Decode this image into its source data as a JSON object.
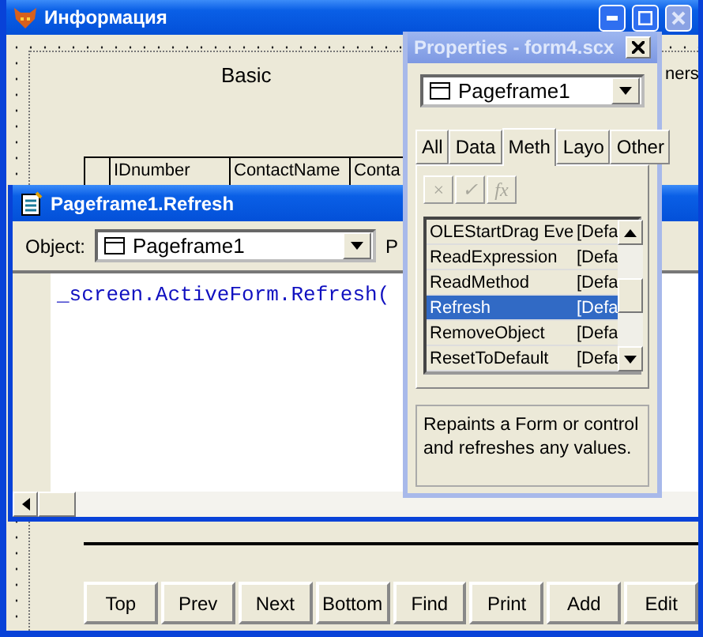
{
  "main_window": {
    "title": "Информация",
    "active": true,
    "page_tabs": [
      "Basic",
      "ners"
    ],
    "grid_columns": [
      "IDnumber",
      "ContactName",
      "Conta"
    ],
    "buttons": [
      "Top",
      "Prev",
      "Next",
      "Bottom",
      "Find",
      "Print",
      "Add",
      "Edit"
    ]
  },
  "code_window": {
    "title": "Pageframe1.Refresh",
    "active": true,
    "object_label": "Object:",
    "object_value": "Pageframe1",
    "procedure_label": "P",
    "code": "_screen.ActiveForm.Refresh("
  },
  "properties": {
    "title": "Properties - form4.scx",
    "active": false,
    "object": "Pageframe1",
    "tabs": [
      {
        "label": "All",
        "selected": false
      },
      {
        "label": "Data",
        "selected": false
      },
      {
        "label": "Meth",
        "selected": true
      },
      {
        "label": "Layo",
        "selected": false
      },
      {
        "label": "Other",
        "selected": false
      }
    ],
    "tools": [
      {
        "label": "×",
        "disabled": true
      },
      {
        "label": "✓",
        "disabled": true
      },
      {
        "label": "fx",
        "disabled": true
      }
    ],
    "rows": [
      {
        "name": "OLEStartDrag Eve",
        "value": "[Defa",
        "selected": false
      },
      {
        "name": "ReadExpression",
        "value": "[Defa",
        "selected": false
      },
      {
        "name": "ReadMethod",
        "value": "[Defa",
        "selected": false
      },
      {
        "name": "Refresh",
        "value": "[Defa",
        "selected": true
      },
      {
        "name": "RemoveObject",
        "value": "[Defa",
        "selected": false
      },
      {
        "name": "ResetToDefault",
        "value": "[Defa",
        "selected": false
      }
    ],
    "description": "Repaints a Form or control and refreshes any values."
  }
}
